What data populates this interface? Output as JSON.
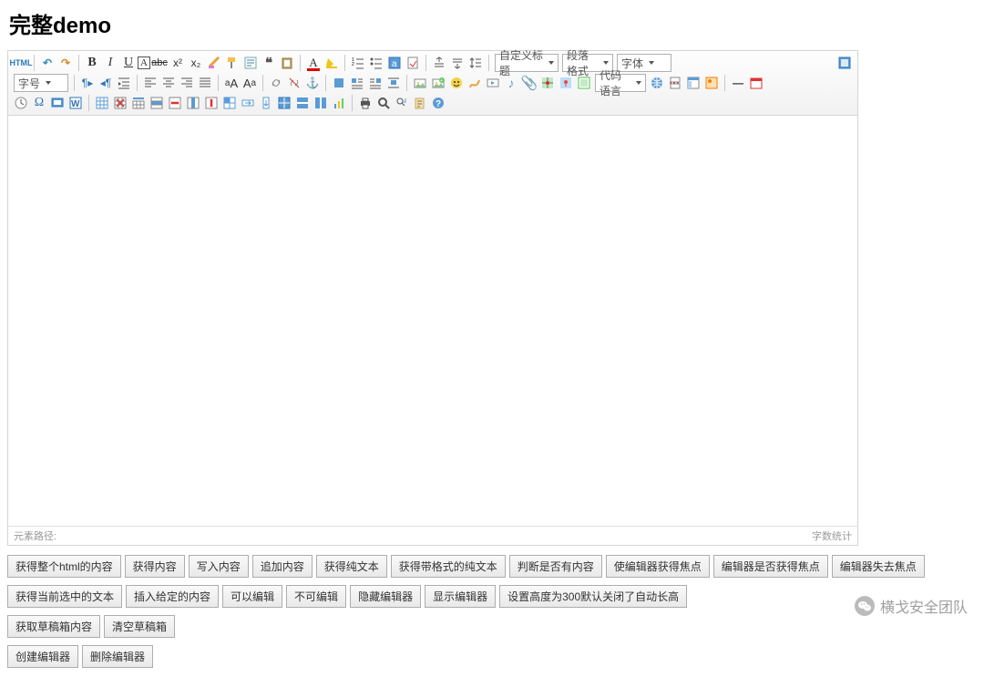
{
  "page_title": "完整demo",
  "dropdowns": {
    "custom_title": "自定义标题",
    "paragraph": "段落格式",
    "font_family": "字体",
    "font_size": "字号",
    "code_lang": "代码语言"
  },
  "status": {
    "path_label": "元素路径:",
    "wordcount_label": "字数统计"
  },
  "buttons": {
    "r1": [
      "获得整个html的内容",
      "获得内容",
      "写入内容",
      "追加内容",
      "获得纯文本",
      "获得带格式的纯文本",
      "判断是否有内容",
      "使编辑器获得焦点",
      "编辑器是否获得焦点",
      "编辑器失去焦点"
    ],
    "r2": [
      "获得当前选中的文本",
      "插入给定的内容",
      "可以编辑",
      "不可编辑",
      "隐藏编辑器",
      "显示编辑器",
      "设置高度为300默认关闭了自动长高"
    ],
    "r3": [
      "获取草稿箱内容",
      "清空草稿箱"
    ],
    "r4": [
      "创建编辑器",
      "删除编辑器"
    ]
  },
  "watermark": "横戈安全团队",
  "icons": {
    "html": "source",
    "undo": "undo",
    "redo": "redo",
    "bold": "bold",
    "italic": "italic",
    "underline": "underline",
    "fontborder": "fontborder",
    "strike": "strikethrough",
    "sup": "superscript",
    "sub": "subscript",
    "removefmt": "removeformat",
    "formatmatch": "formatmatch",
    "autotypeset": "autotypeset",
    "blockquote": "blockquote",
    "pasteplain": "pasteplain",
    "forecolor": "forecolor",
    "backcolor": "backcolor",
    "ol": "insertorderedlist",
    "ul": "insertunorderedlist",
    "selectall": "selectall",
    "cleardoc": "cleardoc",
    "rowspacetop": "rowspacingtop",
    "rowspacebottom": "rowspacingbottom",
    "lineheight": "lineheight",
    "dir_ltr": "directionalityltr",
    "dir_rtl": "directionalityrtl",
    "indent": "indent",
    "outdent": "outdent",
    "alignleft": "justifyleft",
    "aligncenter": "justifycenter",
    "alignright": "justifyright",
    "alignjustify": "justify",
    "touppercase": "touppercase",
    "tolowercase": "tolowercase",
    "link": "link",
    "unlink": "unlink",
    "anchor": "anchor",
    "imagenone": "imagenone",
    "imageleft": "imageleft",
    "imageright": "imageright",
    "imagecenter": "imagecenter",
    "simpleupload": "simpleupload",
    "insertimage": "insertimage",
    "emotion": "emotion",
    "scrawl": "scrawl",
    "insertvideo": "insertvideo",
    "music": "music",
    "attachment": "attachment",
    "map": "map",
    "gmap": "gmap",
    "insertframe": "insertframe",
    "highlightcode": "insertcode",
    "webapp": "webapp",
    "pagebreak": "pagebreak",
    "template": "template",
    "background": "background",
    "horizontal": "horizontal",
    "date": "date",
    "time": "time",
    "spechars": "spechars",
    "snapscreen": "snapscreen",
    "wordimage": "wordimage",
    "table": "inserttable",
    "deltable": "deletetable",
    "insertparagraphbefore": "insertparagraphbeforetable",
    "insertrow": "insertrow",
    "delrow": "deleterow",
    "insertcol": "insertcol",
    "delcol": "deletecol",
    "mergecells": "mergecells",
    "mergeright": "mergeright",
    "mergedown": "mergedown",
    "splitcells": "splittocells",
    "splitrows": "splittorows",
    "splitcols": "splittocols",
    "charts": "charts",
    "print": "print",
    "preview": "preview",
    "searchreplace": "searchreplace",
    "drafts": "drafts",
    "help": "help",
    "fullscreen": "fullscreen"
  }
}
